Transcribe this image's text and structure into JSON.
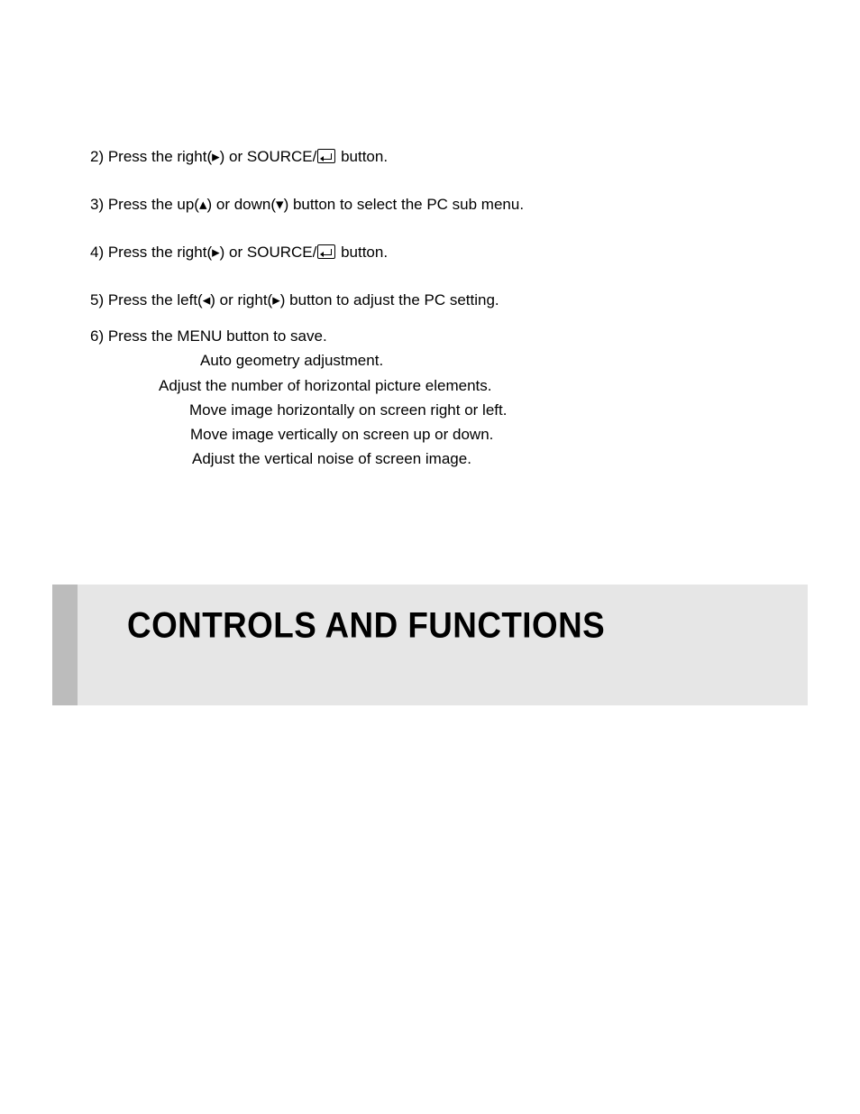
{
  "steps": {
    "s2": {
      "pre": "2) Press the right(",
      "arrow": "▸",
      "mid": ") or SOURCE/",
      "post": "  button."
    },
    "s3": {
      "pre": "3) Press the up(",
      "up": "▴",
      "mid1": ") or down(",
      "down": "▾",
      "post": ") button to select the PC sub menu."
    },
    "s4": {
      "pre": "4) Press the right(",
      "arrow": "▸",
      "mid": ") or SOURCE/",
      "post": "  button."
    },
    "s5": {
      "pre": "5) Press the left(",
      "left": "◂",
      "mid": ") or right(",
      "right": "▸",
      "post": ") button to adjust the PC setting."
    },
    "s6": "6) Press the MENU button to save."
  },
  "descriptions": {
    "d1": "Auto geometry adjustment.",
    "d2": "Adjust the number of horizontal picture elements.",
    "d3": "Move image horizontally on screen right or left.",
    "d4": "Move image vertically on screen up or down.",
    "d5": "Adjust the vertical noise of screen image."
  },
  "banner": {
    "title": "CONTROLS AND FUNCTIONS"
  },
  "icons": {
    "enter": "enter-icon"
  }
}
